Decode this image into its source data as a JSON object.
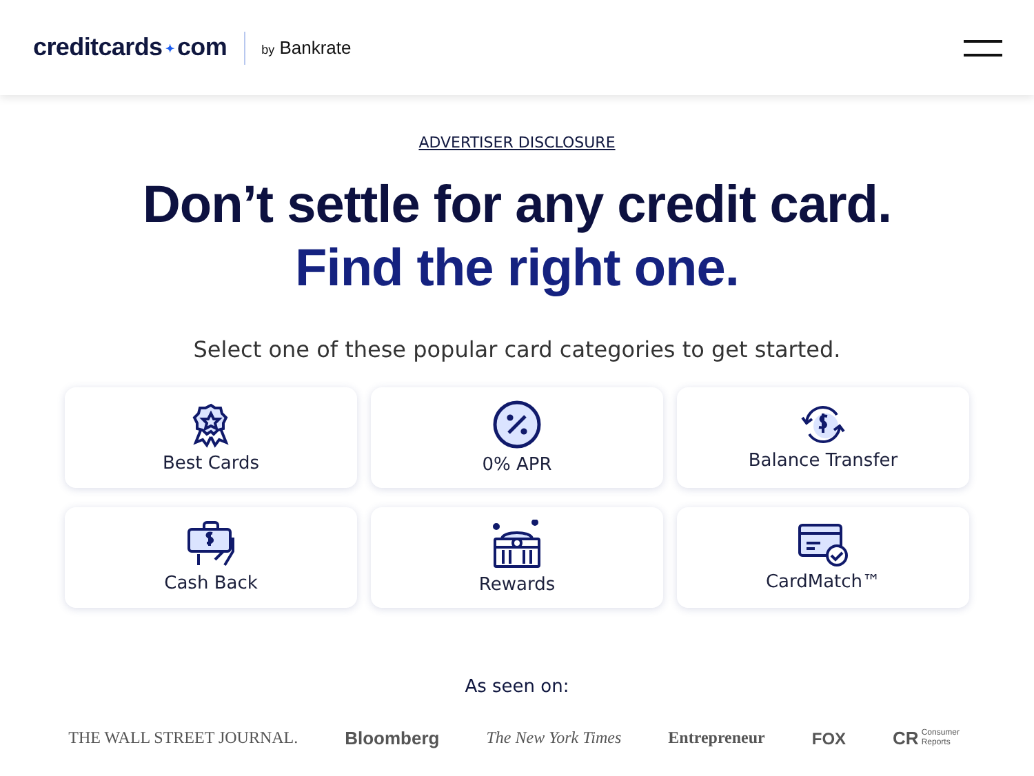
{
  "header": {
    "logo_main": "creditcards",
    "logo_dot": "✦",
    "logo_tld": "com",
    "logo_by": "by",
    "logo_partner": "Bankrate"
  },
  "disclosure": "ADVERTISER DISCLOSURE",
  "headline": [
    "Don’t settle for any credit card.",
    "Find the right one."
  ],
  "subtitle": "Select one of these popular card categories to get started.",
  "categories": [
    {
      "kind": "ribbon",
      "label": "Best Cards"
    },
    {
      "kind": "percent",
      "label": "0% APR"
    },
    {
      "kind": "transfer",
      "label": "Balance Transfer"
    },
    {
      "kind": "cash",
      "label": "Cash Back"
    },
    {
      "kind": "chest",
      "label": "Rewards"
    },
    {
      "kind": "match",
      "label": "CardMatch™"
    }
  ],
  "seen_on": {
    "label": "As seen on:",
    "logos": [
      {
        "kind": "wsj",
        "text": "THE WALL STREET JOURNAL."
      },
      {
        "kind": "bloomberg",
        "text": "Bloomberg"
      },
      {
        "kind": "nyt",
        "text": "The New York Times"
      },
      {
        "kind": "entrepreneur",
        "text": "Entrepreneur"
      },
      {
        "kind": "fox",
        "text": "FOX"
      },
      {
        "kind": "cr",
        "text": "CR",
        "sub": "Consumer Reports"
      }
    ]
  }
}
